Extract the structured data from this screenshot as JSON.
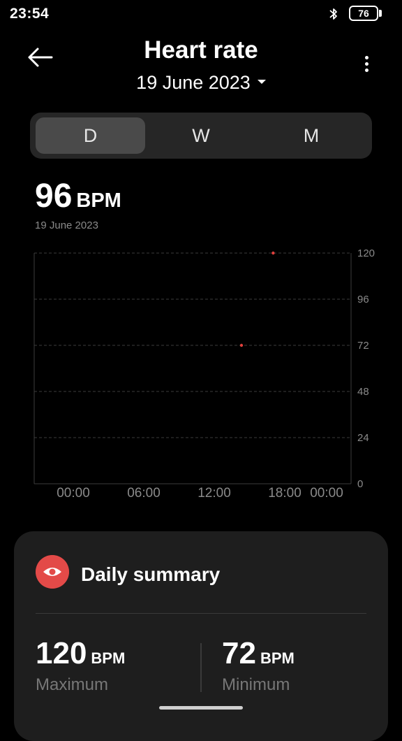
{
  "status_bar": {
    "time": "23:54",
    "battery_level": "76"
  },
  "header": {
    "title": "Heart rate",
    "date": "19 June 2023"
  },
  "tabs": [
    {
      "label": "D",
      "active": true
    },
    {
      "label": "W",
      "active": false
    },
    {
      "label": "M",
      "active": false
    }
  ],
  "reading": {
    "value": "96",
    "unit": "BPM",
    "date": "19 June 2023"
  },
  "chart_data": {
    "type": "scatter",
    "x_tick_labels": [
      "00:00",
      "06:00",
      "12:00",
      "18:00",
      "00:00"
    ],
    "y_ticks": [
      0,
      24,
      48,
      72,
      96,
      120
    ],
    "ylim": [
      0,
      120
    ],
    "xlim_hours": [
      0,
      24
    ],
    "grid": true,
    "series": [
      {
        "points": [
          {
            "x_hours": 15.7,
            "y": 72
          },
          {
            "x_hours": 18.1,
            "y": 120
          }
        ]
      }
    ],
    "colors": {
      "point": "#e0403c",
      "grid": "#3c3c3c",
      "label": "#8a8a8a"
    }
  },
  "summary": {
    "title": "Daily summary",
    "icon": "eye-icon",
    "maximum": {
      "value": "120",
      "unit": "BPM",
      "label": "Maximum"
    },
    "minimum": {
      "value": "72",
      "unit": "BPM",
      "label": "Minimum"
    }
  },
  "colors": {
    "accent": "#e34a48",
    "card": "#1e1e1e",
    "segment_bg": "#262626",
    "segment_active": "#4a4a4a"
  }
}
